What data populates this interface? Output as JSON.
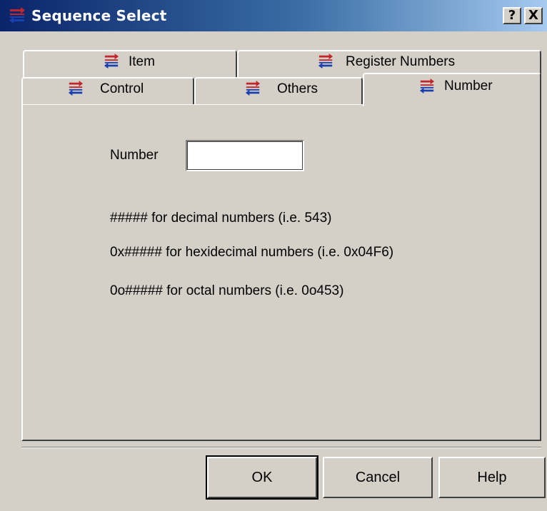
{
  "window": {
    "title": "Sequence Select",
    "help_button": "?",
    "close_button": "X"
  },
  "tabs": {
    "back_row": [
      {
        "label": "Item",
        "icon": "sequence-icon"
      },
      {
        "label": "Register Numbers",
        "icon": "sequence-icon"
      }
    ],
    "front_row": [
      {
        "label": "Control",
        "icon": "sequence-icon"
      },
      {
        "label": "Others",
        "icon": "sequence-icon"
      },
      {
        "label": "Number",
        "icon": "sequence-icon",
        "selected": true
      }
    ]
  },
  "number_tab": {
    "number_label": "Number",
    "number_value": "",
    "hint_decimal": "##### for decimal numbers (i.e. 543)",
    "hint_hex": "0x##### for hexidecimal numbers (i.e. 0x04F6)",
    "hint_octal": "0o##### for octal numbers (i.e. 0o453)"
  },
  "buttons": {
    "ok": "OK",
    "cancel": "Cancel",
    "help": "Help"
  },
  "colors": {
    "titlebar_start": "#0a246a",
    "titlebar_end": "#a6caf0",
    "dialog_face": "#d4d0c8",
    "icon_red": "#c0262c",
    "icon_blue": "#1a3fb0"
  }
}
